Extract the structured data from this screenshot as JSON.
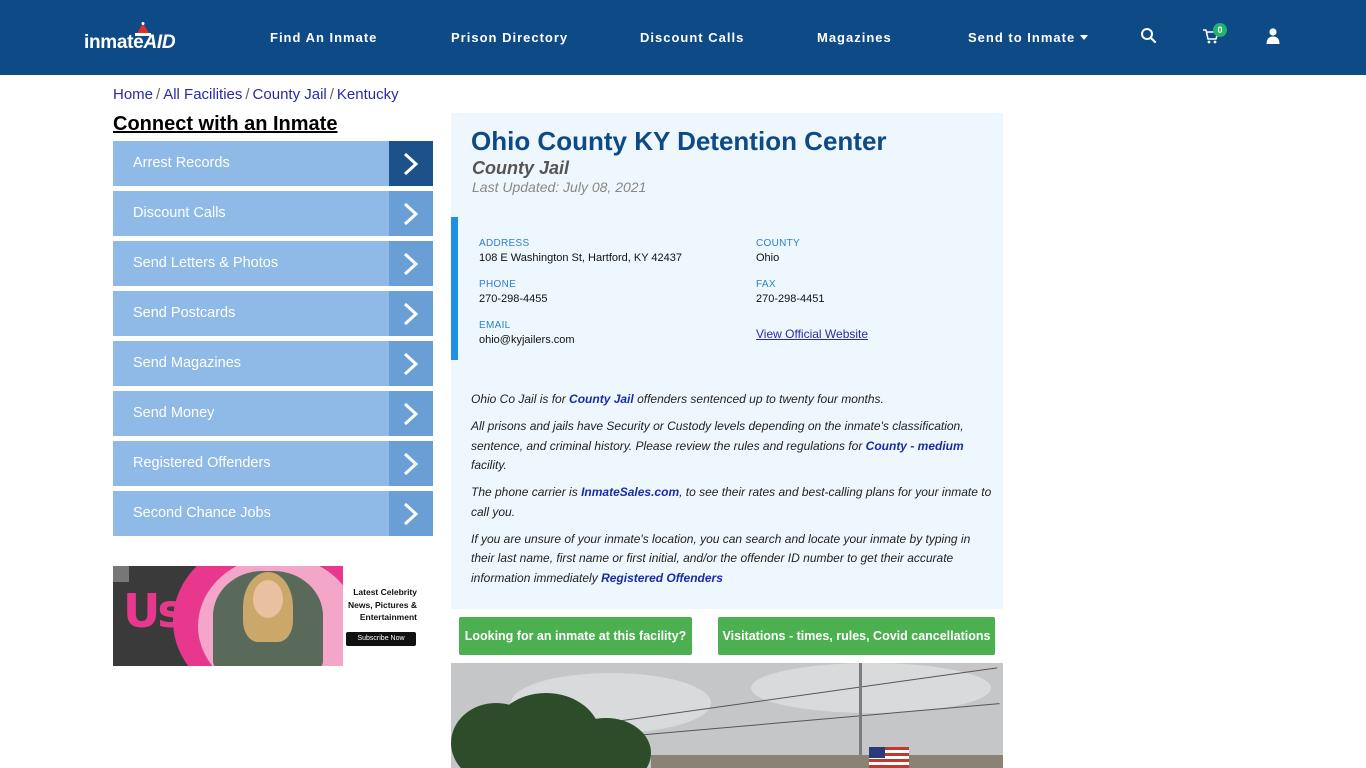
{
  "brand": {
    "logo_text_main": "inmate",
    "logo_text_accent": "AID"
  },
  "nav": {
    "items": [
      {
        "label": "Find An Inmate"
      },
      {
        "label": "Prison Directory"
      },
      {
        "label": "Discount Calls"
      },
      {
        "label": "Magazines"
      },
      {
        "label": "Send to Inmate"
      }
    ],
    "cart_count": "0",
    "icons": [
      "search-icon",
      "cart-icon",
      "user-icon"
    ]
  },
  "breadcrumb": {
    "items": [
      "Home",
      "All Facilities",
      "County Jail",
      "Kentucky"
    ],
    "separator": "/"
  },
  "sidebar": {
    "heading": "Connect with an Inmate",
    "items": [
      {
        "label": "Arrest Records"
      },
      {
        "label": "Discount Calls"
      },
      {
        "label": "Send Letters & Photos"
      },
      {
        "label": "Send Postcards"
      },
      {
        "label": "Send Magazines"
      },
      {
        "label": "Send Money"
      },
      {
        "label": "Registered Offenders"
      },
      {
        "label": "Second Chance Jobs"
      }
    ]
  },
  "ad": {
    "brand": "Us",
    "tagline": "Latest Celebrity News, Pictures & Entertainment",
    "button": "Subscribe Now"
  },
  "facility": {
    "name": "Ohio County KY Detention Center",
    "type": "County Jail",
    "last_updated": "Last Updated: July 08, 2021",
    "address_label": "ADDRESS",
    "address": "108 E Washington St, Hartford, KY 42437",
    "county_label": "COUNTY",
    "county": "Ohio",
    "phone_label": "PHONE",
    "phone": "270-298-4455",
    "fax_label": "FAX",
    "fax": "270-298-4451",
    "email_label": "EMAIL",
    "email": "ohio@kyjailers.com",
    "website_link": "View Official Website"
  },
  "description": {
    "p1_a": "Ohio Co Jail is for ",
    "p1_link": "County Jail",
    "p1_b": " offenders sentenced up to twenty four months.",
    "p2_a": "All prisons and jails have Security or Custody levels depending on the inmate's classification, sentence, and criminal history. Please review the rules and regulations for ",
    "p2_link": "County - medium",
    "p2_b": " facility.",
    "p3_a": "The phone carrier is ",
    "p3_link": "InmateSales.com",
    "p3_b": ", to see their rates and best-calling plans for your inmate to call you.",
    "p4_a": "If you are unsure of your inmate's location, you can search and locate your inmate by typing in their last name, first name or first initial, and/or the offender ID number to get their accurate information immediately ",
    "p4_link": "Registered Offenders"
  },
  "actions": {
    "find_inmate": "Looking for an inmate at this facility?",
    "visitations": "Visitations - times, rules, Covid cancellations"
  },
  "colors": {
    "nav_bg": "#0d4a86",
    "sidebar_item": "#8fb9e6",
    "sidebar_arrow": "#6a9fd6",
    "sidebar_arrow_active": "#1c5289",
    "panel_bg": "#eef7fd",
    "accent_bar": "#1e90e6",
    "action_green": "#4caf50"
  }
}
